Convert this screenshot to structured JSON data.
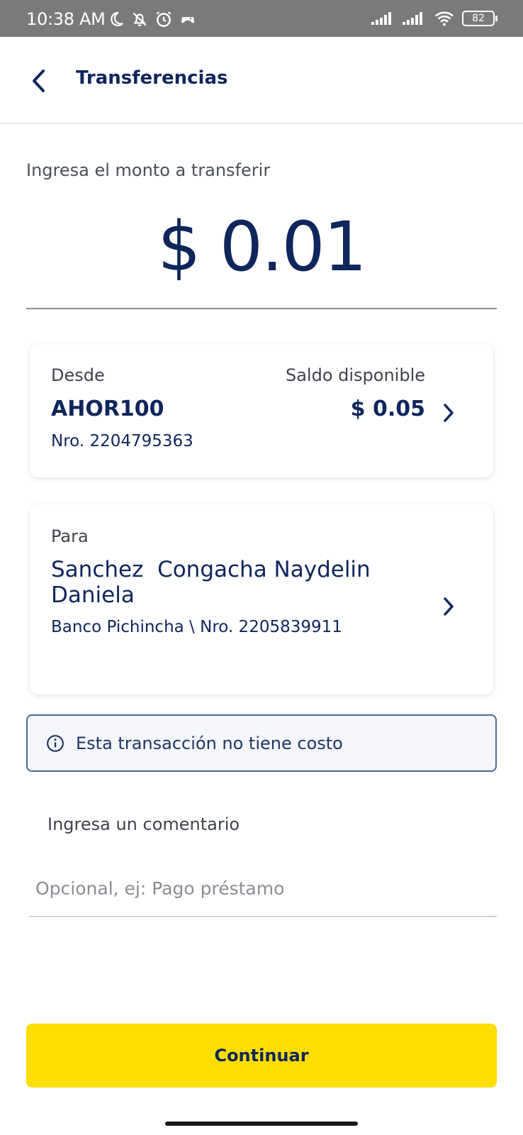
{
  "status_bar": {
    "time": "10:38 AM",
    "battery": "82"
  },
  "header": {
    "title": "Transferencias"
  },
  "amount": {
    "label": "Ingresa el monto a transferir",
    "value": "$ 0.01"
  },
  "from": {
    "label": "Desde",
    "account": "AHOR100",
    "number": "Nro. 2204795363",
    "balance_label": "Saldo disponible",
    "balance": "$ 0.05"
  },
  "to": {
    "label": "Para",
    "name": "Sanchez  Congacha Naydelin Daniela",
    "bank_info": "Banco Pichincha \\ Nro. 2205839911"
  },
  "info": {
    "text": "Esta transacción no tiene costo"
  },
  "comment": {
    "label": "Ingresa un comentario",
    "placeholder": "Opcional, ej: Pago préstamo"
  },
  "actions": {
    "continue_label": "Continuar"
  },
  "colors": {
    "primary": "#0f265c",
    "accent": "#ffdd00",
    "status_bar": "#7a7a7a"
  }
}
